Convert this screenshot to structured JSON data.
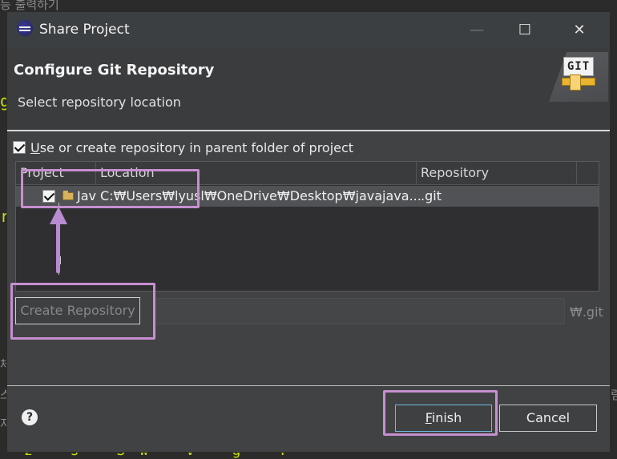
{
  "background": {
    "top_text": "등 출력하기",
    "left_chars": [
      "g",
      "r",
      "체",
      "스",
      "저"
    ],
    "right_char": "림",
    "bottom_code": "z s Sw V g T"
  },
  "window": {
    "title": "Share Project",
    "icon": "eclipse-icon",
    "controls": {
      "minimize": "—",
      "maximize": "☐",
      "close": "✕"
    }
  },
  "header": {
    "title": "Configure Git Repository",
    "subtitle": "Select repository location",
    "banner_text": "GIT"
  },
  "use_parent": {
    "checked": true,
    "label_underlined": "U",
    "label_rest": "se or create repository in parent folder of project"
  },
  "table": {
    "columns": [
      "Project",
      "Location",
      "Repository"
    ],
    "rows": [
      {
        "checked": true,
        "project": "Jav",
        "location": "C:₩Users₩lyusl₩OneDrive₩Desktop₩javajava...",
        "repository": ".git"
      }
    ]
  },
  "create": {
    "button_label": "Create Repository",
    "input_value": "",
    "suffix": "₩.git"
  },
  "footer": {
    "help_icon": "help-icon",
    "finish_underlined": "F",
    "finish_rest": "inish",
    "cancel_label": "Cancel"
  },
  "colors": {
    "annotation": "#c78fd0",
    "dialog_bg": "#414244",
    "accent_focus": "#6dbbe0"
  }
}
